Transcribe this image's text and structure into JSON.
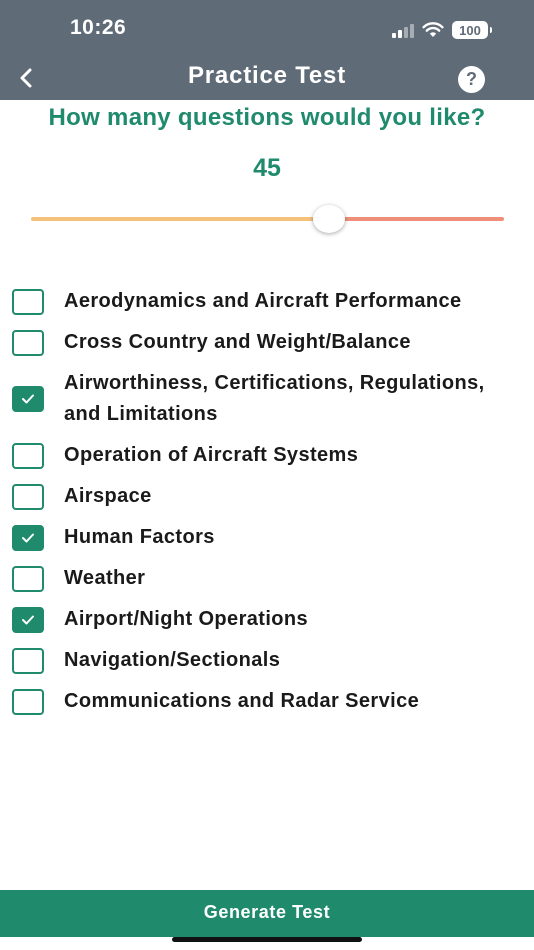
{
  "status_bar": {
    "time": "10:26",
    "battery": "100"
  },
  "nav": {
    "title": "Practice Test",
    "help": "?"
  },
  "question": "How many questions would you like?",
  "slider": {
    "value": "45",
    "fraction": 0.63
  },
  "topics": [
    {
      "label": "Aerodynamics and Aircraft Performance",
      "checked": false
    },
    {
      "label": "Cross Country and Weight/Balance",
      "checked": false
    },
    {
      "label": "Airworthiness, Certifications, Regulations, and Limitations",
      "checked": true
    },
    {
      "label": "Operation of Aircraft Systems",
      "checked": false
    },
    {
      "label": "Airspace",
      "checked": false
    },
    {
      "label": "Human Factors",
      "checked": true
    },
    {
      "label": "Weather",
      "checked": false
    },
    {
      "label": "Airport/Night Operations",
      "checked": true
    },
    {
      "label": "Navigation/Sectionals",
      "checked": false
    },
    {
      "label": "Communications and Radar Service",
      "checked": false
    }
  ],
  "generate_label": "Generate Test",
  "colors": {
    "header": "#5f6b77",
    "accent": "#1f8a6c",
    "slider_left": "#f5c07a",
    "slider_right": "#ef8f7a"
  },
  "icons": {
    "back": "chevron-left-icon",
    "help": "question-icon",
    "check": "checkmark-icon"
  }
}
